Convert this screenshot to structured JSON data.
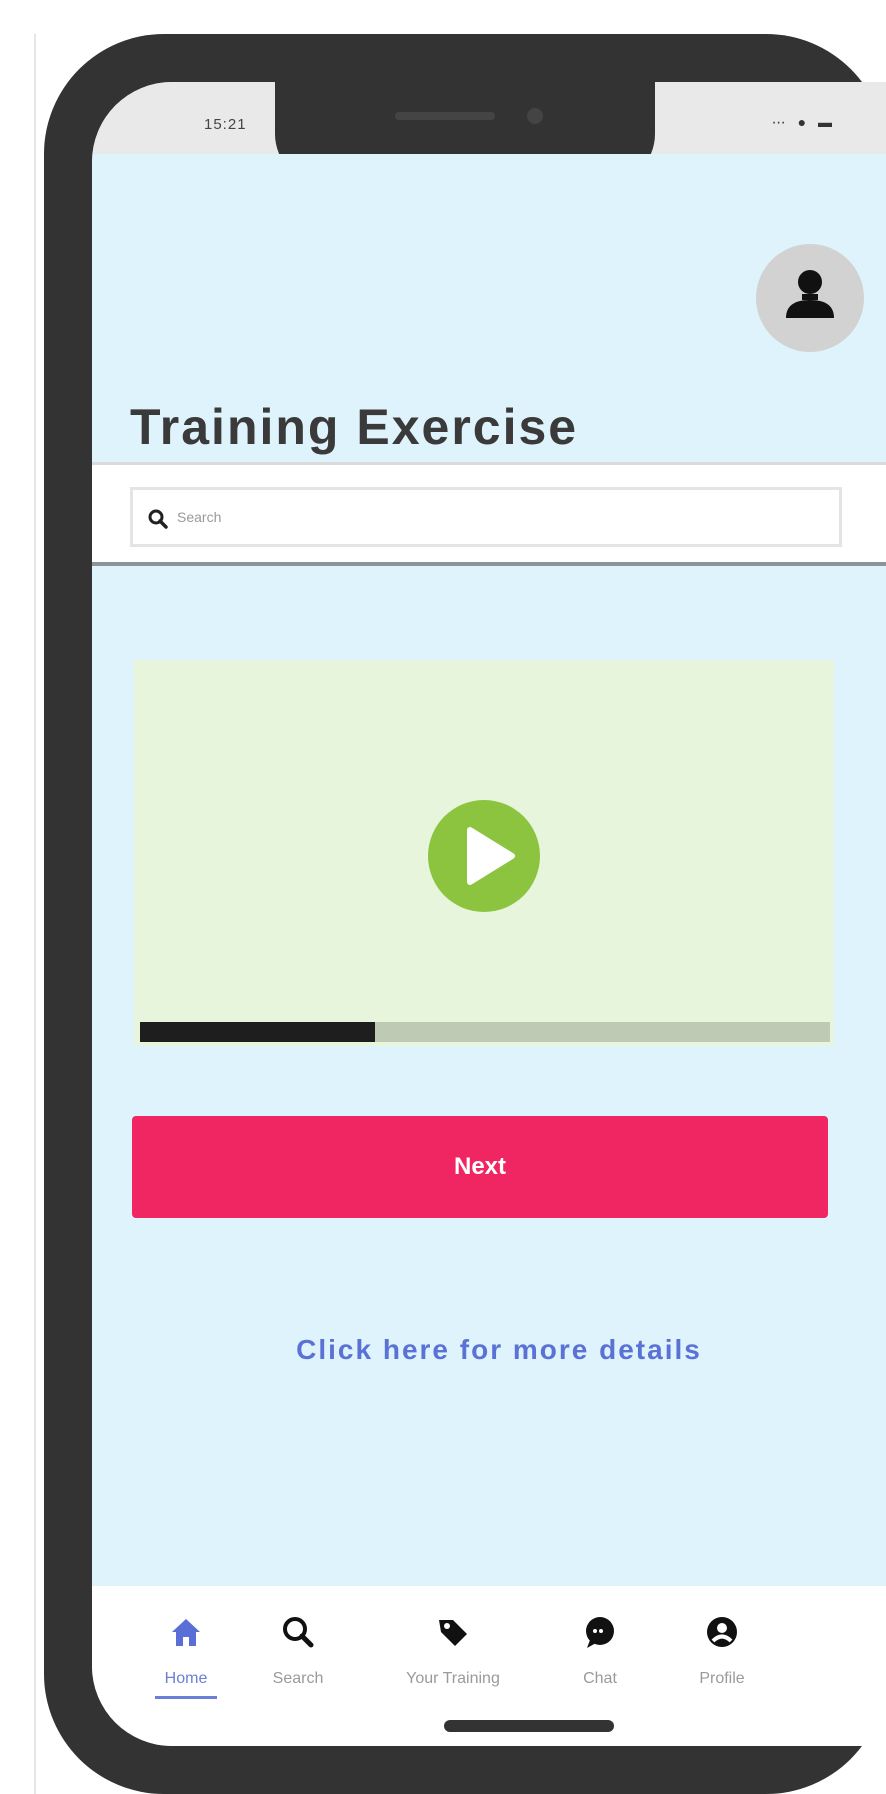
{
  "status_bar": {
    "time": "15:21",
    "icons": "⋯ ● ▬"
  },
  "header": {
    "title": "Training Exercise"
  },
  "search": {
    "placeholder": "Search"
  },
  "video": {
    "progress_fraction": 0.34
  },
  "actions": {
    "next_label": "Next",
    "details_link": "Click here for more details"
  },
  "nav": {
    "items": [
      {
        "label": "Home",
        "icon": "home-icon",
        "active": true
      },
      {
        "label": "Search",
        "icon": "search-icon",
        "active": false
      },
      {
        "label": "Your Training",
        "icon": "tag-icon",
        "active": false
      },
      {
        "label": "Chat",
        "icon": "chat-icon",
        "active": false
      },
      {
        "label": "Profile",
        "icon": "profile-icon",
        "active": false
      }
    ]
  },
  "colors": {
    "screen_bg": "#dff3fc",
    "video_bg": "#e6f5dc",
    "play_green": "#8cc43f",
    "accent_pink": "#ef2661",
    "link_blue": "#5a72d6",
    "nav_active": "#6b7fd8"
  }
}
